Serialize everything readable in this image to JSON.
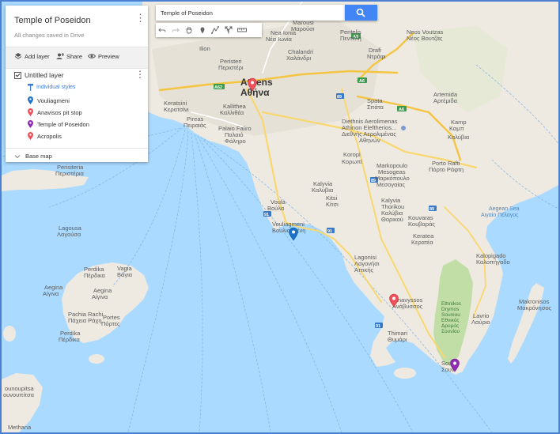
{
  "panel": {
    "title": "Temple of Poseidon",
    "saved_status": "All changes saved in Drive",
    "toolbar": {
      "add_layer": "Add layer",
      "share": "Share",
      "preview": "Preview"
    },
    "layer": {
      "name": "Untitled layer",
      "styles_link": "Individual styles",
      "places": [
        {
          "name": "Vouliagmeni",
          "color": "#1a73c8"
        },
        {
          "name": "Anavisos pit stop",
          "color": "#f0505a"
        },
        {
          "name": "Temple of Poseidon",
          "color": "#8e2cb3"
        },
        {
          "name": "Acropolis",
          "color": "#f0505a"
        }
      ]
    },
    "base_map": "Base map"
  },
  "search": {
    "value": "Temple of Poseidon"
  },
  "tools": [
    "undo-icon",
    "redo-icon",
    "hand-icon",
    "marker-icon",
    "draw-line-icon",
    "directions-icon",
    "ruler-icon"
  ],
  "map": {
    "labels": {
      "athens": "Athens",
      "athens_gr": "Αθήνα",
      "marousi": "Marousi",
      "marousi_gr": "Μαρούσι",
      "nea_ionia": "Nea Ionia",
      "nea_ionia_gr": "Νέα Ιωνία",
      "pentelis": "Pentelis",
      "pentelis_gr": "Πεντέλη",
      "neos_voutzas": "Neos Voutzas",
      "neos_voutzas_gr": "Νέος Βουτζάς",
      "drafi": "Drafi",
      "drafi_gr": "Ντράφι",
      "chalandri": "Chalandri",
      "chalandri_gr": "Χαλάνδρι",
      "peristeri": "Peristeri",
      "peristeri_gr": "Περιστέρι",
      "ilion": "Ilion",
      "keratsini": "Keratsini",
      "keratsini_gr": "Κερατσίνι",
      "pireas": "Pireas",
      "pireas_gr": "Πειραιάς",
      "kallithea": "Kallithea",
      "kallithea_gr": "Καλλιθέα",
      "palaio_faliro": "Palaio Faliro",
      "palaio_faliro_gr": "Παλαιό",
      "faliro_gr": "Φάληρο",
      "spata": "Spata",
      "spata_gr": "Σπάτα",
      "artemida": "Artemida",
      "artemida_gr": "Αρτέμιδα",
      "airport": "Diethnis Aerolimenas",
      "airport2": "Athinon Eleftherios...",
      "airport_gr": "Διεθνής Αερολιμένας",
      "airport_gr2": "Αθηνών",
      "kalyvia_gr_top": "Καλύβια",
      "kamp": "Kamp",
      "kamp_gr": "Καμπ",
      "koropi": "Koropi",
      "koropi_gr": "Κορωπί",
      "markopoulo": "Markopoulo",
      "mesogeia": "Mesogeas",
      "markopoulo_gr": "Μαρκόπουλο",
      "mesogeia_gr": "Μεσογαίας",
      "porto_rafti": "Porto Rafti",
      "porto_rafti_gr": "Πόρτο Ράφτη",
      "kalyvia": "Kalyvia",
      "kalyvia_gr": "Καλύβια",
      "kitsi": "Kitsi",
      "kitsi_gr": "Κίτσι",
      "kalyvia_thorikou": "Kalyvia",
      "thorikou": "Thorikou",
      "kalyvia_thorikou_gr": "Καλύβια",
      "thorikou_gr": "Θορικού",
      "kouvaras": "Kouvaras",
      "kouvaras_gr": "Κουβαράς",
      "voula": "Voula",
      "voula_gr": "Βούλα",
      "vouliagmeni": "Vouliagmeni",
      "vouliagmeni_gr": "Βουλιαγμένη",
      "keratea": "Keratea",
      "keratea_gr": "Κερατέα",
      "lagonisi": "Lagonisi",
      "lagonisi_gr": "Λαγονήσι",
      "attikis_gr": "Αττικής",
      "anavyssos": "Anavyssos",
      "anavyssos_gr": "Ανάβυσσος",
      "thimari": "Thimari",
      "thimari_gr": "Θυμάρι",
      "kalopigado": "Kalopigado",
      "kalopigado_gr": "Καλοπήγαδο",
      "ethnikos": "Ethnikos",
      "drymos": "Drymos",
      "souniou": "Souniou",
      "ethnikos_gr": "Εθνικός",
      "drymos_gr": "Δρυμός",
      "souniou_gr": "Σουνίου",
      "lavrio": "Lavrio",
      "lavrio_gr": "Λαύριο",
      "makronisos": "Makronisos",
      "makronisos_gr": "Μακρόνησος",
      "sounio": "Sou",
      "sounio_gr": "Σουν",
      "perdika": "Perdika",
      "perdika_gr": "Πέρδικα",
      "vagia": "Vagia",
      "vagia_gr": "Βάγια",
      "aegina": "Aegina",
      "aegina_gr": "Αίγινα",
      "pachia_rachi": "Pachia Rachi",
      "pachia_rachi_gr": "Πάχεια Ράχη",
      "portes": "Portes",
      "portes_gr": "Πόρτες",
      "perdika2": "Perdika",
      "perdika2_gr": "Πέρδικα",
      "persteria": "Perisiteria",
      "persteria_gr": "Περιστέρια",
      "lagousa": "Lagousa",
      "lagousa_gr": "Λαγούσα",
      "methana": "Methana",
      "lounoupitsa": "ounoupitsa",
      "lounoupitsa_gr": "ουνουπίτσα",
      "aegean": "Aegean Sea",
      "aegean_gr": "Αιγαίο Πέλαγος"
    },
    "shields": [
      "A8",
      "A6",
      "A6",
      "A62",
      "89",
      "91",
      "91",
      "89",
      "89",
      "91"
    ]
  }
}
